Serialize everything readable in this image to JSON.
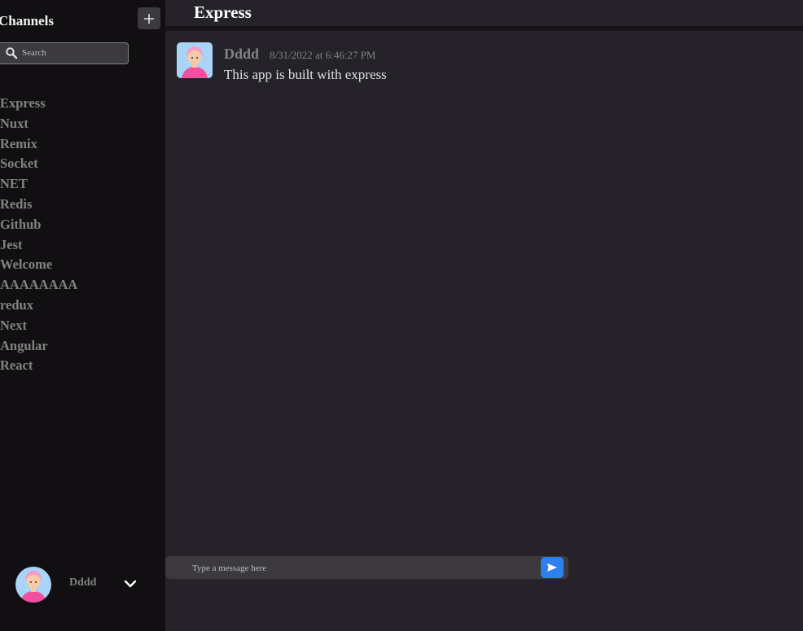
{
  "sidebar": {
    "title": "Channels",
    "add_icon": "plus-icon",
    "search": {
      "placeholder": "Search",
      "value": "",
      "icon": "search-icon"
    },
    "channels": [
      {
        "label": "Express"
      },
      {
        "label": "Nuxt"
      },
      {
        "label": "Remix"
      },
      {
        "label": "Socket"
      },
      {
        "label": "NET"
      },
      {
        "label": "Redis"
      },
      {
        "label": "Github"
      },
      {
        "label": "Jest"
      },
      {
        "label": "Welcome"
      },
      {
        "label": "AAAAAAAA"
      },
      {
        "label": "redux"
      },
      {
        "label": "Next"
      },
      {
        "label": "Angular"
      },
      {
        "label": "React"
      }
    ],
    "user": {
      "name": "Dddd",
      "menu_icon": "chevron-down-icon"
    }
  },
  "header": {
    "title": "Express"
  },
  "messages": [
    {
      "author": "Dddd",
      "timestamp": "8/31/2022 at 6:46:27 PM",
      "text": "This app is built with express"
    }
  ],
  "composer": {
    "placeholder": "Type a message here",
    "value": "",
    "send_icon": "send-icon"
  },
  "colors": {
    "sidebar_bg": "#120f13",
    "main_bg": "#252329",
    "input_bg": "#3c393f",
    "accent": "#2f80ed",
    "muted_text": "#828282"
  }
}
